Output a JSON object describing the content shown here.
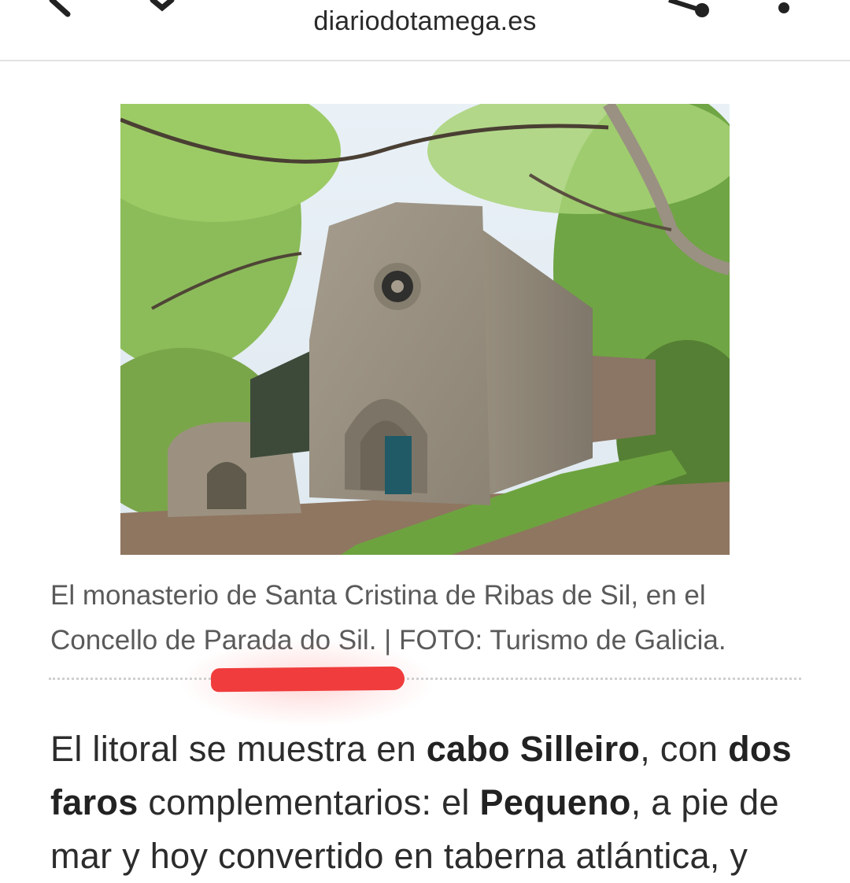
{
  "browser": {
    "url": "diariodotamega.es",
    "icons": [
      "back-icon",
      "download-icon",
      "share-icon",
      "more-icon"
    ]
  },
  "photo": {
    "subject": "monastery-church-photo"
  },
  "caption": {
    "line1": "El monasterio de Santa Cristina de Ribas de Sil, en el",
    "line2": "Concello de Parada do Sil. | FOTO: Turismo de Galicia."
  },
  "annotation": {
    "color": "#f03c3c"
  },
  "article": {
    "p1_a": "El litoral se muestra en ",
    "p1_b": "cabo Silleiro",
    "p1_c": ", con ",
    "p1_d": "dos faros",
    "p1_e": " complementarios: el ",
    "p1_f": "Pequeno",
    "p1_g": ", a pie de mar y hoy convertido en taberna atlántica, y"
  }
}
